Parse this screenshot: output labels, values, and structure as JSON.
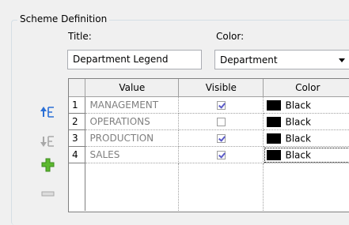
{
  "group": {
    "title": "Scheme Definition"
  },
  "form": {
    "title_label": "Title:",
    "title_value": "Department Legend",
    "color_label": "Color:",
    "color_value": "Department"
  },
  "toolbar": {
    "icons": [
      "move-up-icon",
      "move-down-icon",
      "add-icon",
      "remove-icon"
    ]
  },
  "grid": {
    "columns": [
      "Value",
      "Visible",
      "Color"
    ],
    "rows": [
      {
        "num": "1",
        "value": "MANAGEMENT",
        "visible": true,
        "color": "Black",
        "swatch": "#000000"
      },
      {
        "num": "2",
        "value": "OPERATIONS",
        "visible": false,
        "color": "Black",
        "swatch": "#000000"
      },
      {
        "num": "3",
        "value": "PRODUCTION",
        "visible": true,
        "color": "Black",
        "swatch": "#000000"
      },
      {
        "num": "4",
        "value": "SALES",
        "visible": true,
        "color": "Black",
        "swatch": "#000000"
      }
    ]
  },
  "colors": {
    "accent_green": "#5cb82e",
    "accent_blue": "#2a6fd6",
    "disabled_gray": "#a8a8a8"
  }
}
